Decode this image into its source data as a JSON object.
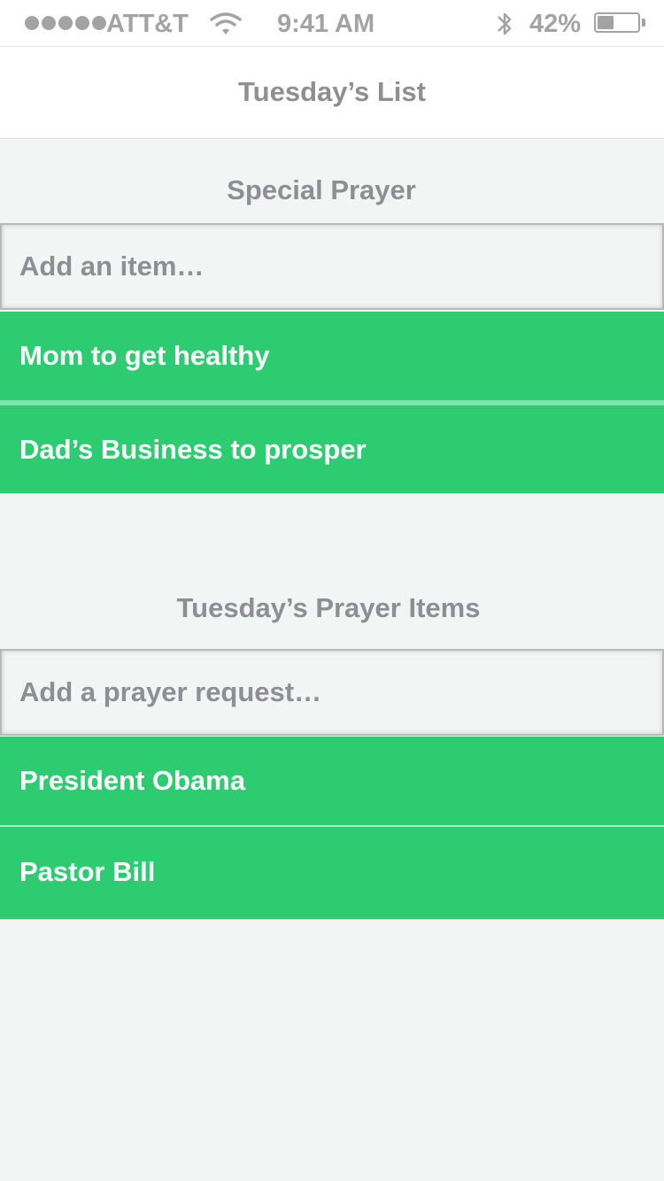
{
  "status_bar": {
    "carrier": "ATT&T",
    "time": "9:41 AM",
    "battery_percent": "42%",
    "battery_level": 0.42,
    "signal_bars": 5,
    "icons": [
      "signal-dots-icon",
      "wifi-icon",
      "bluetooth-icon",
      "battery-icon"
    ]
  },
  "nav": {
    "title": "Tuesday’s List"
  },
  "special_prayer": {
    "title": "Special Prayer",
    "input_placeholder": "Add an item…",
    "items": [
      {
        "label": "Mom to get healthy"
      },
      {
        "label": "Dad’s Business to prosper"
      }
    ]
  },
  "prayer_items": {
    "title": "Tuesday’s Prayer Items",
    "input_placeholder": "Add a prayer request…",
    "items": [
      {
        "label": "President Obama"
      },
      {
        "label": "Pastor Bill"
      }
    ]
  },
  "colors": {
    "item_green": "#2ecc71",
    "text_gray": "#8e8e93",
    "background": "#f3f4f4"
  }
}
